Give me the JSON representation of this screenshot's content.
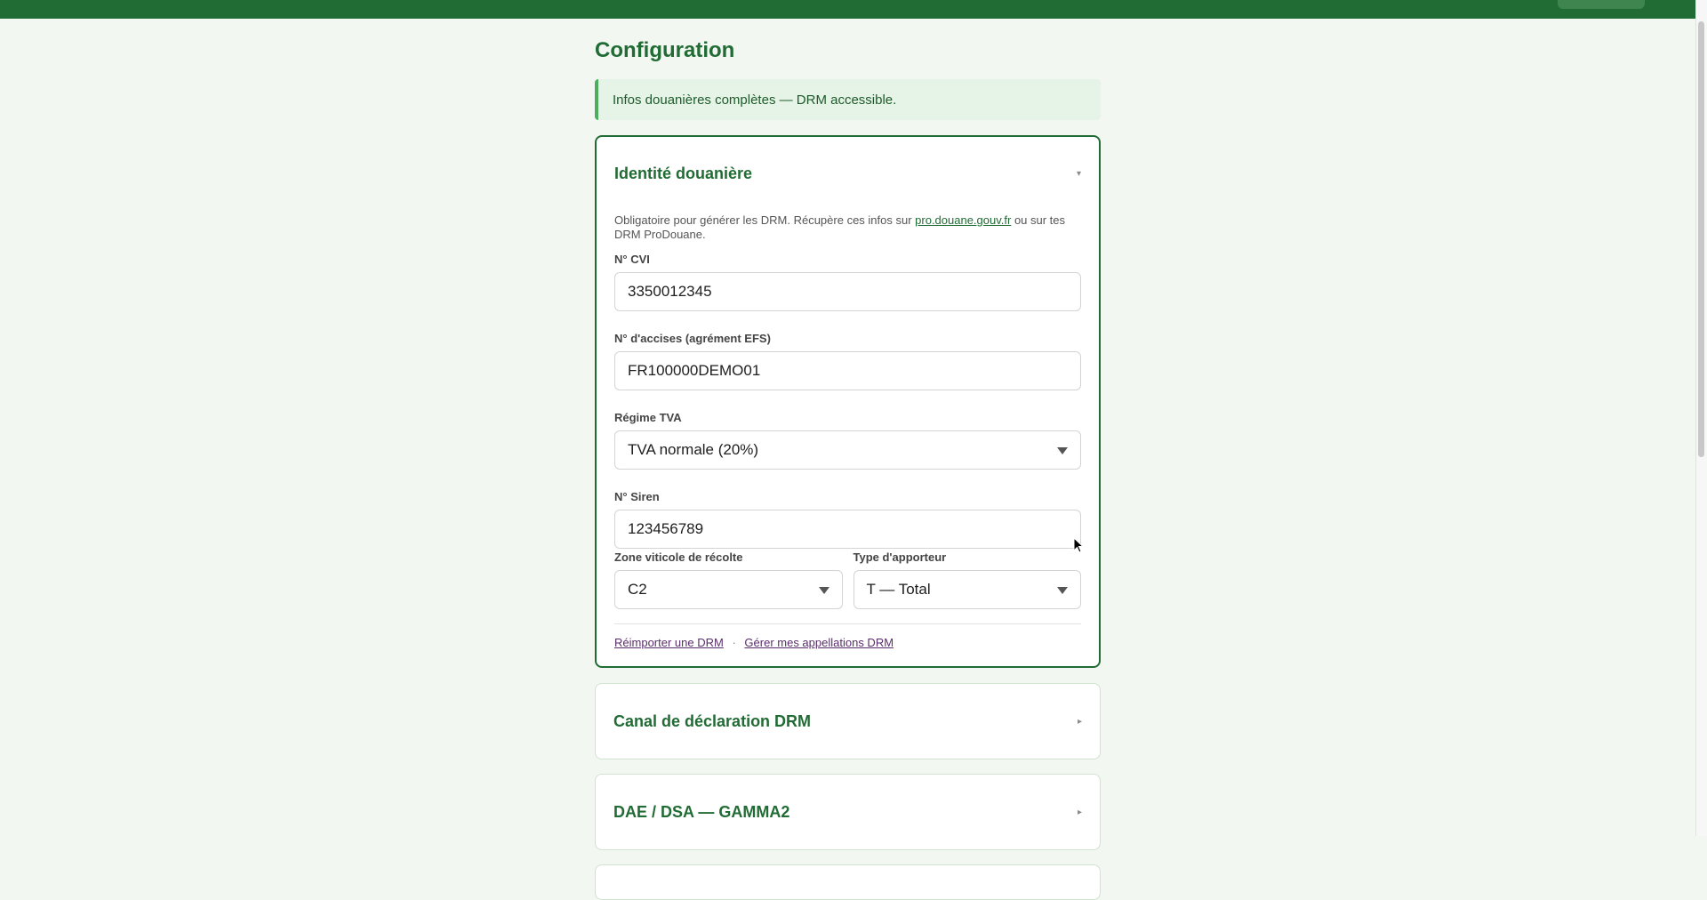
{
  "page": {
    "title": "Configuration"
  },
  "alert": {
    "text": "Infos douanières complètes — DRM accessible."
  },
  "identite": {
    "title": "Identité douanière",
    "help_prefix": "Obligatoire pour générer les DRM. Récupère ces infos sur ",
    "help_link": "pro.douane.gouv.fr",
    "help_suffix": " ou sur tes DRM ProDouane.",
    "cvi": {
      "label": "N° CVI",
      "value": "3350012345"
    },
    "accises": {
      "label": "N° d'accises (agrément EFS)",
      "value": "FR100000DEMO01"
    },
    "tva": {
      "label": "Régime TVA",
      "value": "TVA normale (20%)"
    },
    "siren": {
      "label": "N° Siren",
      "value": "123456789"
    },
    "zone": {
      "label": "Zone viticole de récolte",
      "value": "C2"
    },
    "apporteur": {
      "label": "Type d'apporteur",
      "value": "T — Total"
    },
    "link_reimport": "Réimporter une DRM",
    "link_sep": "·",
    "link_appellations": "Gérer mes appellations DRM"
  },
  "canal": {
    "title": "Canal de déclaration DRM"
  },
  "dae": {
    "title": "DAE / DSA — GAMMA2"
  },
  "icons": {
    "open_arrow": "▾",
    "closed_arrow": "▸"
  },
  "colors": {
    "brand": "#216b34",
    "alert_bg": "#e6f4e7",
    "alert_border": "#4caf5f",
    "link": "#5a2d6b"
  }
}
